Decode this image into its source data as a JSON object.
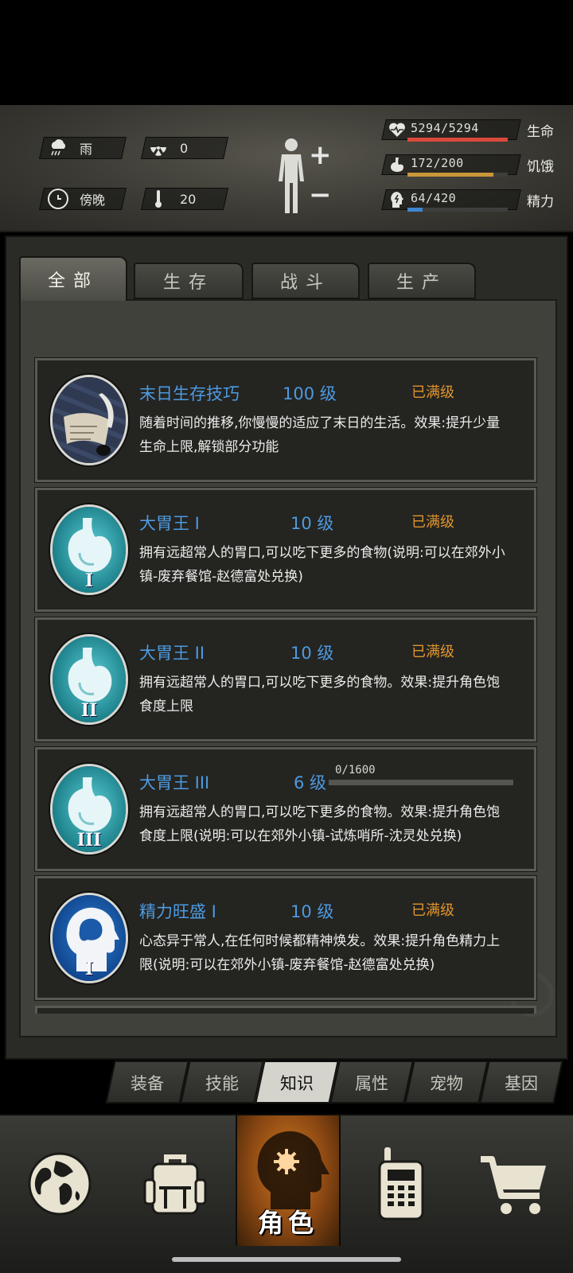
{
  "header": {
    "weather": "雨",
    "radiation": "0",
    "time_of_day": "傍晚",
    "temperature": "20",
    "stats": [
      {
        "icon": "heart-icon",
        "value": "5294/5294",
        "label": "生命",
        "fraction": 1.0,
        "color": "#d9493b"
      },
      {
        "icon": "stomach-icon",
        "value": "172/200",
        "label": "饥饿",
        "fraction": 0.86,
        "color": "#c9963a"
      },
      {
        "icon": "energy-head-icon",
        "value": "64/420",
        "label": "精力",
        "fraction": 0.152,
        "color": "#3f86cf"
      }
    ]
  },
  "tabs": [
    "全部",
    "生存",
    "战斗",
    "生产"
  ],
  "skills": [
    {
      "title": "末日生存技巧",
      "level": "100 级",
      "status": "已满级",
      "desc": "随着时间的推移,你慢慢的适应了末日的生活。效果:提升少量生命上限,解锁部分功能",
      "emblem": "scroll-quill-icon"
    },
    {
      "title": "大胃王 I",
      "level": "10 级",
      "status": "已满级",
      "desc": "拥有远超常人的胃口,可以吃下更多的食物(说明:可以在郊外小镇-废弃餐馆-赵德富处兑换)",
      "emblem": "stomach-icon",
      "numeral": "I"
    },
    {
      "title": "大胃王 II",
      "level": "10 级",
      "status": "已满级",
      "desc": "拥有远超常人的胃口,可以吃下更多的食物。效果:提升角色饱食度上限",
      "emblem": "stomach-icon",
      "numeral": "II"
    },
    {
      "title": "大胃王 III",
      "level": "6 级",
      "progress": "0/1600",
      "progress_fraction": 0.0,
      "desc": "拥有远超常人的胃口,可以吃下更多的食物。效果:提升角色饱食度上限(说明:可以在郊外小镇-试炼哨所-沈灵处兑换)",
      "emblem": "stomach-icon",
      "numeral": "III"
    },
    {
      "title": "精力旺盛 I",
      "level": "10 级",
      "status": "已满级",
      "desc": "心态异于常人,在任何时候都精神焕发。效果:提升角色精力上限(说明:可以在郊外小镇-废弃餐馆-赵德富处兑换)",
      "emblem": "brain-head-icon",
      "numeral": "I"
    }
  ],
  "subtabs": [
    "装备",
    "技能",
    "知识",
    "属性",
    "宠物",
    "基因"
  ],
  "subtab_active": "知识",
  "nav": {
    "active_label": "角色"
  }
}
